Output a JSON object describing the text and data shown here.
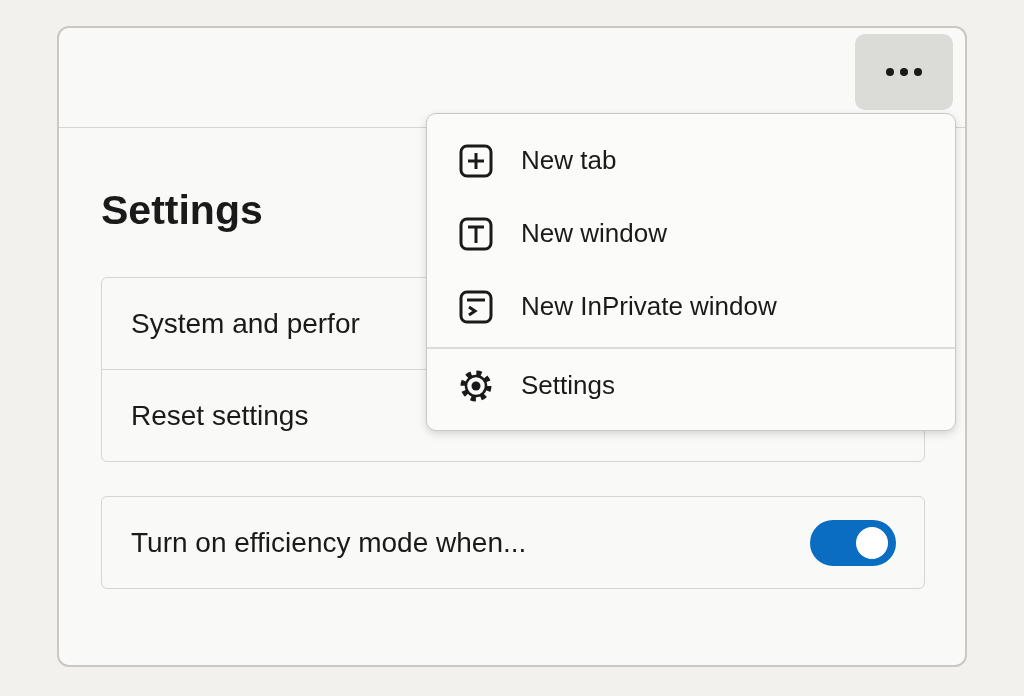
{
  "title": "Settings",
  "settings_list": [
    {
      "label": "System and perfor"
    },
    {
      "label": "Reset settings"
    }
  ],
  "efficiency": {
    "label": "Turn on efficiency mode when...",
    "on": true
  },
  "menu": {
    "sections": [
      [
        {
          "label": "New tab"
        },
        {
          "label": "New window"
        },
        {
          "label": "New InPrivate window"
        }
      ],
      [
        {
          "label": "Settings"
        }
      ]
    ]
  }
}
